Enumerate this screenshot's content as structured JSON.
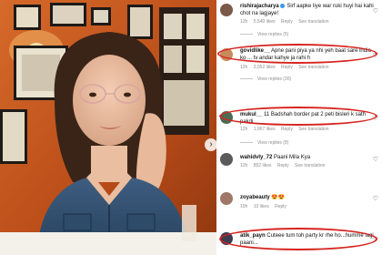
{
  "photo": {
    "alt_nav": "›"
  },
  "comments": [
    {
      "user": "rishirajacharya",
      "verified": true,
      "text": "Sirf aapke liye war ruki huyi hai kahi chot na lagjaye!",
      "time": "12h",
      "likes": "5,540 likes",
      "reply": "Reply",
      "translation": "See translation",
      "replies": "View replies (5)"
    },
    {
      "user": "govidlike__",
      "verified": false,
      "text": "Apne pani piya ya nhi yeh baat sare india ko ... tv andar kahye ja rahi h",
      "time": "12h",
      "likes": "2,052 likes",
      "reply": "Reply",
      "translation": "See translation",
      "replies": "View replies (30)"
    },
    {
      "user": "mukul__",
      "verified": false,
      "text": "11 Badshah border pat 2 peti bisleri k sath pakdi",
      "time": "12h",
      "likes": "1,967 likes",
      "reply": "Reply",
      "translation": "See translation",
      "replies": "View replies (8)"
    },
    {
      "user": "wahidvly_72",
      "verified": false,
      "text": "Paani Mila Kya",
      "time": "12h",
      "likes": "852 likes",
      "reply": "Reply",
      "translation": "See translation",
      "replies": ""
    },
    {
      "user": "zoyabeauty",
      "verified": false,
      "text": "😍😍",
      "time": "10h",
      "likes": "10 likes",
      "reply": "Reply",
      "translation": "",
      "replies": ""
    },
    {
      "user": "atik_payn",
      "verified": false,
      "text": "Cuteee tum toh party kr rhe ho...humme lagi paani...",
      "time": "11h",
      "likes": "",
      "reply": "",
      "translation": "",
      "replies": ""
    }
  ],
  "colors": {
    "highlight": "#d7241f",
    "background_wall": "#c8561e"
  }
}
